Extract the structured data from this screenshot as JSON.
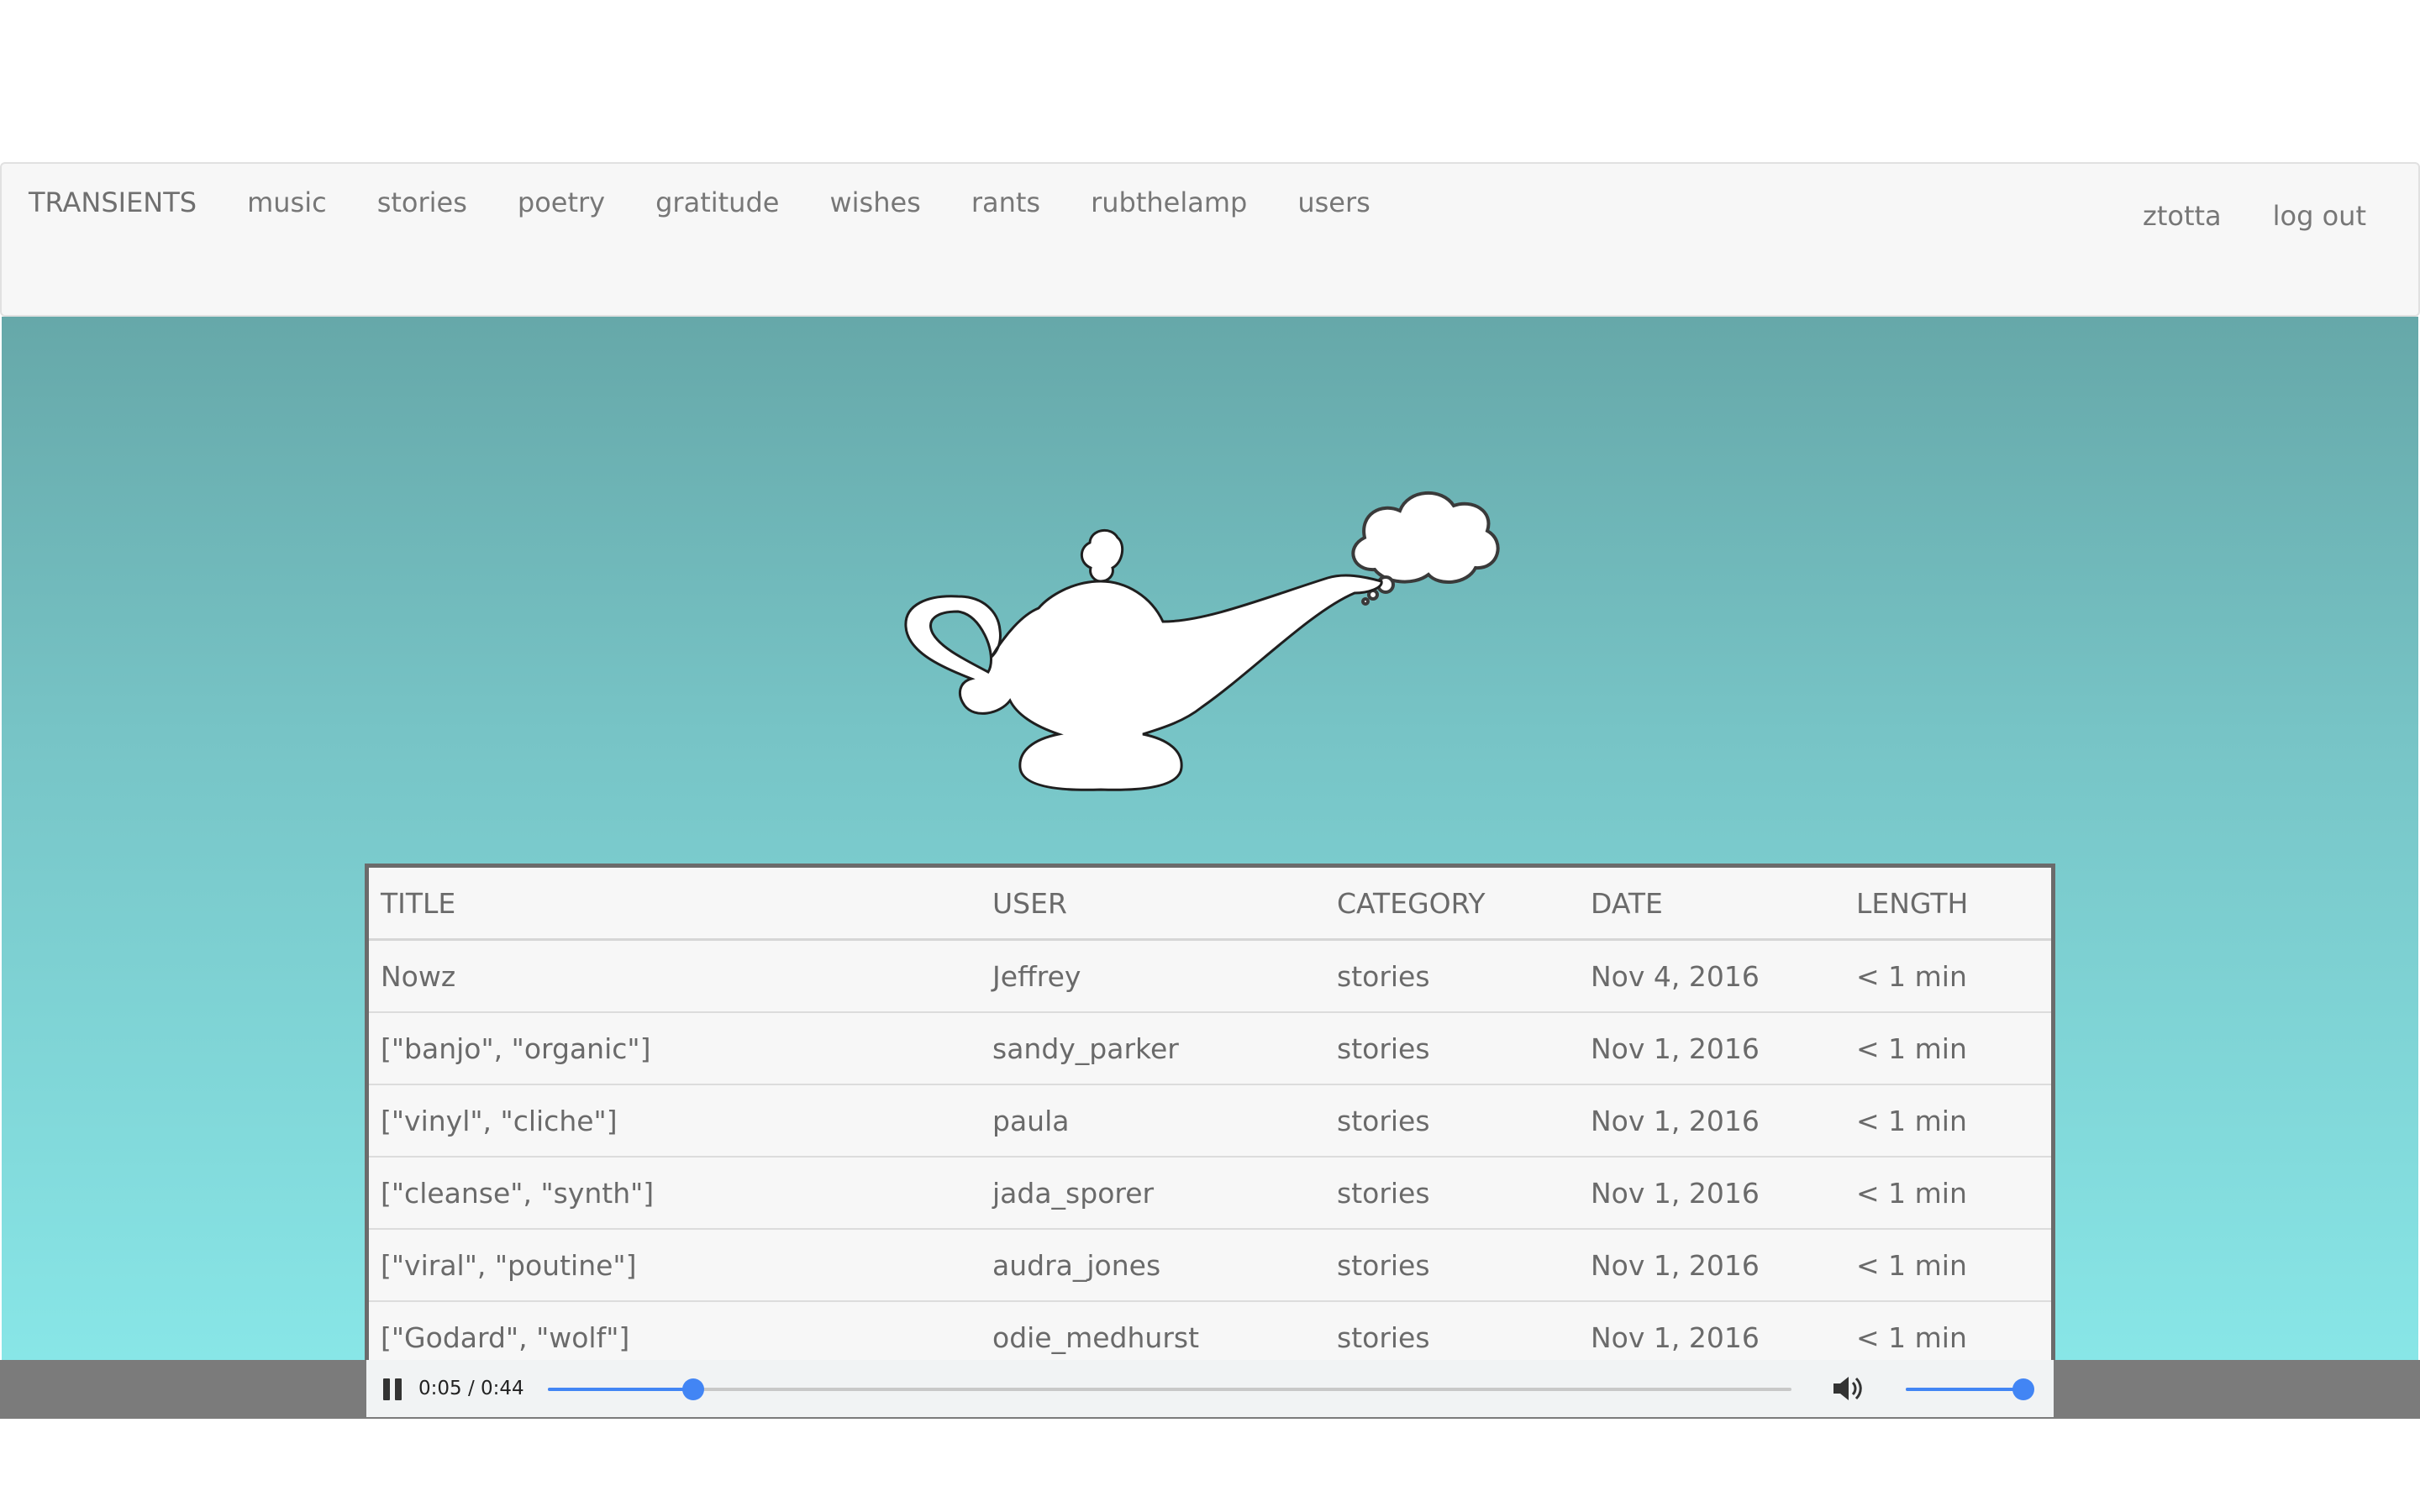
{
  "nav": {
    "brand": "TRANSIENTS",
    "links": [
      "music",
      "stories",
      "poetry",
      "gratitude",
      "wishes",
      "rants",
      "rubthelamp",
      "users"
    ],
    "username": "ztotta",
    "logout": "log out"
  },
  "hero": {
    "illustration": "magic-lamp-with-thought-bubble-icon"
  },
  "table": {
    "headers": [
      "TITLE",
      "USER",
      "CATEGORY",
      "DATE",
      "LENGTH"
    ],
    "rows": [
      {
        "title": "Nowz",
        "user": "Jeffrey",
        "category": "stories",
        "date": "Nov 4, 2016",
        "length": "< 1 min"
      },
      {
        "title": "[\"banjo\", \"organic\"]",
        "user": "sandy_parker",
        "category": "stories",
        "date": "Nov 1, 2016",
        "length": "< 1 min"
      },
      {
        "title": "[\"vinyl\", \"cliche\"]",
        "user": "paula",
        "category": "stories",
        "date": "Nov 1, 2016",
        "length": "< 1 min"
      },
      {
        "title": "[\"cleanse\", \"synth\"]",
        "user": "jada_sporer",
        "category": "stories",
        "date": "Nov 1, 2016",
        "length": "< 1 min"
      },
      {
        "title": "[\"viral\", \"poutine\"]",
        "user": "audra_jones",
        "category": "stories",
        "date": "Nov 1, 2016",
        "length": "< 1 min"
      },
      {
        "title": "[\"Godard\", \"wolf\"]",
        "user": "odie_medhurst",
        "category": "stories",
        "date": "Nov 1, 2016",
        "length": "< 1 min"
      }
    ]
  },
  "player": {
    "time": "0:05 / 0:44",
    "progress_fraction": 0.117,
    "volume_fraction": 1.0,
    "icons": {
      "play_state": "pause-icon",
      "volume": "volume-icon"
    }
  },
  "colors": {
    "gradient_top": "#66a8a9",
    "gradient_bottom": "#88e6e7",
    "accent": "#4285f4",
    "nav_text": "#777777"
  }
}
